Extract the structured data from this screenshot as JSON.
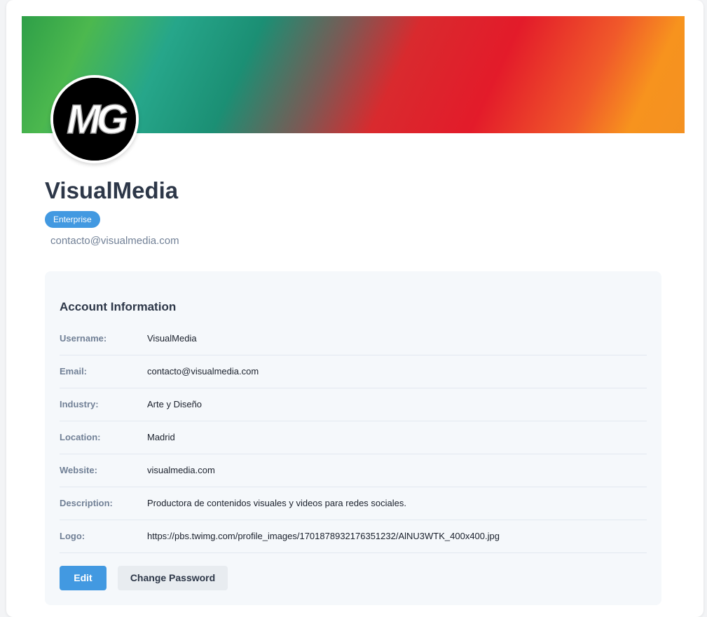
{
  "profile": {
    "name": "VisualMedia",
    "badge": "Enterprise",
    "email": "contacto@visualmedia.com",
    "avatar_logo_text": "MG"
  },
  "account": {
    "title": "Account Information",
    "rows": [
      {
        "label": "Username:",
        "value": "VisualMedia"
      },
      {
        "label": "Email:",
        "value": "contacto@visualmedia.com"
      },
      {
        "label": "Industry:",
        "value": "Arte y Diseño"
      },
      {
        "label": "Location:",
        "value": "Madrid"
      },
      {
        "label": "Website:",
        "value": "visualmedia.com"
      },
      {
        "label": "Description:",
        "value": "Productora de contenidos visuales y videos para redes sociales."
      },
      {
        "label": "Logo:",
        "value": "https://pbs.twimg.com/profile_images/1701878932176351232/AlNU3WTK_400x400.jpg"
      }
    ]
  },
  "actions": {
    "edit_label": "Edit",
    "change_password_label": "Change Password"
  },
  "colors": {
    "accent": "#4299e1",
    "cover_gradient": [
      "#2e9f48",
      "#26a68a",
      "#e31b2a",
      "#f7931e"
    ]
  }
}
